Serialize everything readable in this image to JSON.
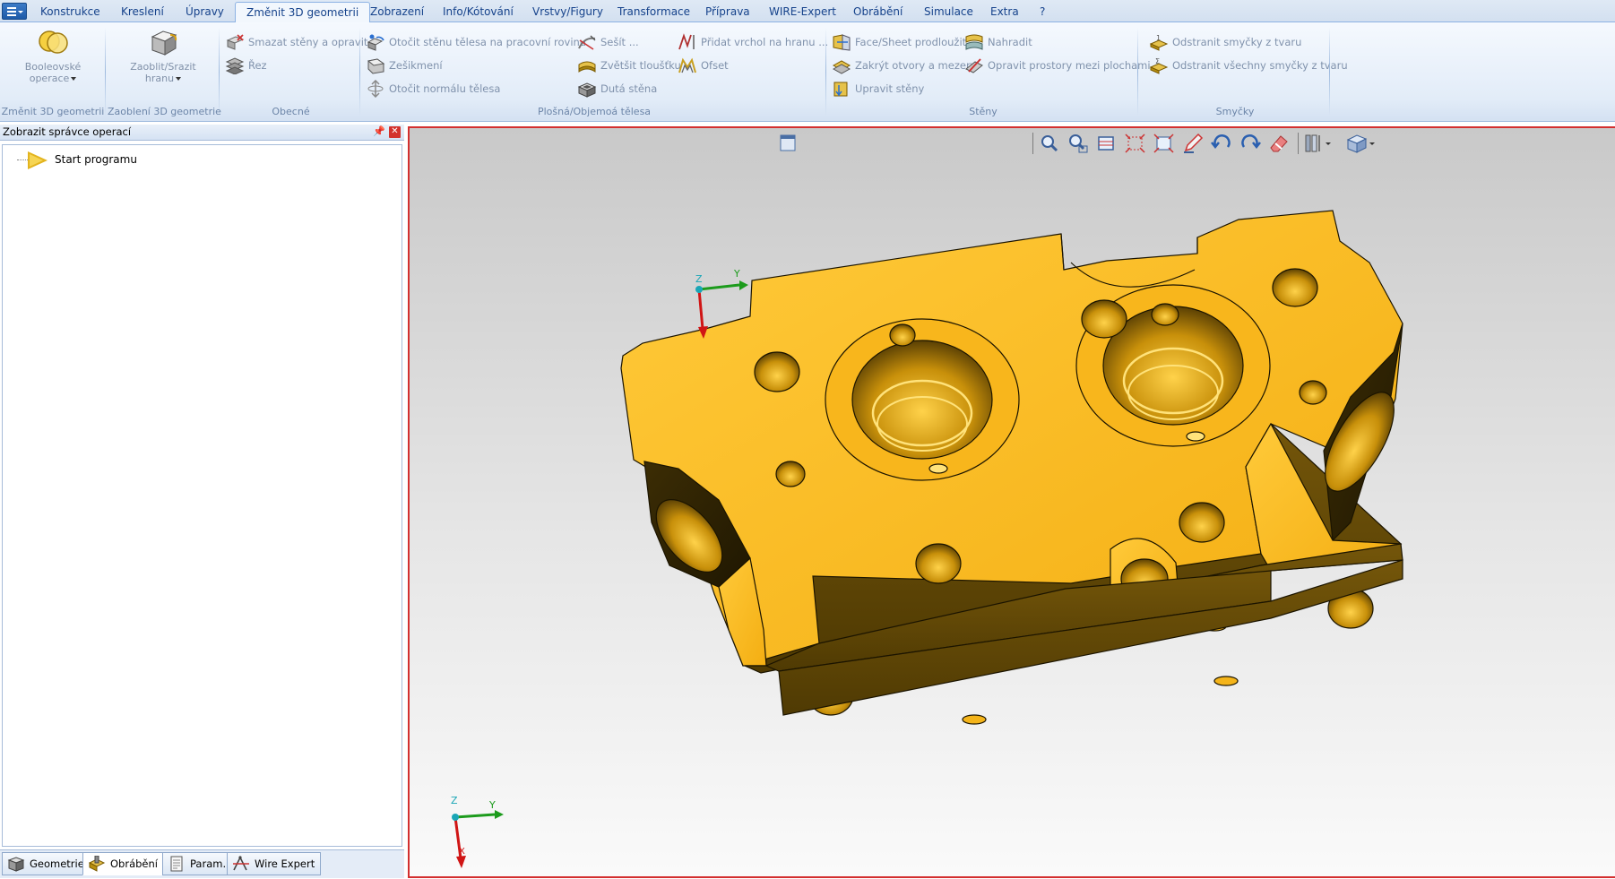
{
  "tabs": [
    {
      "label": "Konstrukce",
      "active": false
    },
    {
      "label": "Kreslení",
      "active": false
    },
    {
      "label": "Úpravy",
      "active": false
    },
    {
      "label": "Změnit 3D geometrii",
      "active": true
    },
    {
      "label": "Zobrazení",
      "active": false
    },
    {
      "label": "Info/Kótování",
      "active": false
    },
    {
      "label": "Vrstvy/Figury",
      "active": false
    },
    {
      "label": "Transformace",
      "active": false
    },
    {
      "label": "Příprava",
      "active": false
    },
    {
      "label": "WIRE-Expert",
      "active": false
    },
    {
      "label": "Obrábění",
      "active": false
    },
    {
      "label": "Simulace",
      "active": false
    },
    {
      "label": "Extra",
      "active": false
    },
    {
      "label": "?",
      "active": false
    }
  ],
  "ribbon": {
    "group_zmenit": {
      "label": "Změnit 3D geometrii",
      "boolean_line1": "Booleovské",
      "boolean_line2": "operace"
    },
    "group_zaobleni": {
      "label": "Zaoblení 3D geometrie",
      "fillet_line1": "Zaoblit/Srazit",
      "fillet_line2": "hranu"
    },
    "group_obecne": {
      "label": "Obecné",
      "delete_faces": "Smazat stěny a opravit",
      "section": "Řez"
    },
    "group_plosna": {
      "label": "Plošná/Objemoá tělesa",
      "rotate_face": "Otočit stěnu tělesa na pracovní rovinu",
      "chamfer": "Zešikmení",
      "flip_normal": "Otočit normálu tělesa",
      "sew": "Sešít ...",
      "thicken": "Zvětšit tloušťku",
      "hollow": "Dutá stěna",
      "add_vertex": "Přidat vrchol na hranu ...",
      "offset": "Ofset"
    },
    "group_steny": {
      "label": "Stěny",
      "extend": "Face/Sheet prodloužit",
      "close_holes": "Zakrýt otvory a mezery",
      "edit_faces": "Upravit stěny",
      "replace": "Nahradit",
      "repair_gaps": "Opravit prostory mezi plochami"
    },
    "group_smycky": {
      "label": "Smyčky",
      "remove_loops": "Odstranit smyčky z tvaru",
      "remove_all_loops": "Odstranit všechny smyčky z tvaru"
    }
  },
  "panel": {
    "title": "Zobrazit správce operací",
    "pin_icon": "pin-icon",
    "tree_root": "Start programu"
  },
  "bottom_tabs": [
    {
      "label": "Geometrie",
      "icon": "cube-icon"
    },
    {
      "label": "Obrábění",
      "icon": "machining-icon",
      "active": true
    },
    {
      "label": "Param.",
      "icon": "document-icon"
    },
    {
      "label": "Wire Expert",
      "icon": "wire-icon"
    }
  ],
  "viewport": {
    "axis_top": {
      "x": "X",
      "y": "Y",
      "z": "Z"
    },
    "axis_bottom": {
      "x": "X",
      "y": "Y",
      "z": "Z"
    },
    "toolbar_icons": [
      "zoom-icon",
      "zoom-window-icon",
      "zoom-all-icon",
      "fit-icon",
      "fit-selection-icon",
      "pen-icon",
      "undo-view-icon",
      "redo-view-icon",
      "eraser-icon",
      "render-mode-icon",
      "view-cube-icon"
    ],
    "colors": {
      "part_light": "#fbbd24",
      "part_mid": "#e8a30e",
      "part_dark": "#6b4d02",
      "border_active": "#d32f2f"
    }
  }
}
